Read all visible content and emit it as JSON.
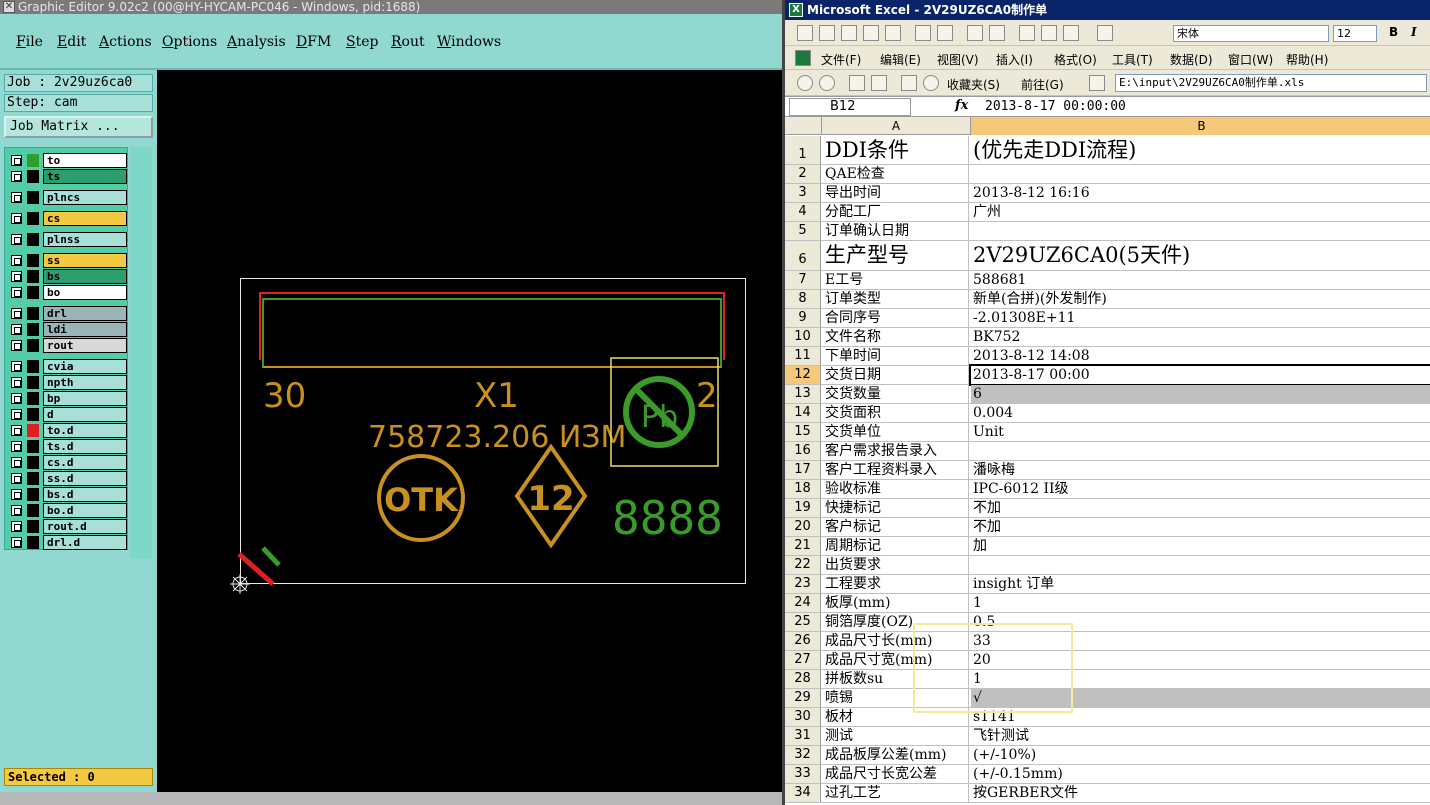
{
  "editor": {
    "title": "Graphic Editor 9.02c2 (00@HY-HYCAM-PC046 - Windows, pid:1688)",
    "menu": [
      "File",
      "Edit",
      "Actions",
      "Options",
      "Analysis",
      "DFM",
      "Step",
      "Rout",
      "Windows"
    ],
    "job": "Job : 2v29uz6ca0",
    "step": "Step: cam",
    "job_matrix_label": "Job Matrix ...",
    "layers": [
      {
        "name": "to",
        "color": "#ffffff",
        "swatch": "#2e9e2e"
      },
      {
        "name": "ts",
        "color": "#2e9e6e",
        "swatch": "#000000"
      },
      {
        "name": "plncs",
        "color": "#a8dfd8",
        "swatch": "#000000"
      },
      {
        "name": "cs",
        "color": "#f5c842",
        "swatch": "#000000"
      },
      {
        "name": "plnss",
        "color": "#a8dfd8",
        "swatch": "#000000"
      },
      {
        "name": "ss",
        "color": "#f5c842",
        "swatch": "#000000"
      },
      {
        "name": "bs",
        "color": "#2e9e6e",
        "swatch": "#000000"
      },
      {
        "name": "bo",
        "color": "#ffffff",
        "swatch": "#000000"
      },
      {
        "name": "drl",
        "color": "#9ab4b8",
        "swatch": "#000000"
      },
      {
        "name": "ldi",
        "color": "#9ab4b8",
        "swatch": "#000000"
      },
      {
        "name": "rout",
        "color": "#d8d8d8",
        "swatch": "#000000"
      },
      {
        "name": "cvia",
        "color": "#a8dfd8",
        "swatch": "#000000"
      },
      {
        "name": "npth",
        "color": "#a8dfd8",
        "swatch": "#000000"
      },
      {
        "name": "bp",
        "color": "#a8dfd8",
        "swatch": "#000000"
      },
      {
        "name": "d",
        "color": "#a8dfd8",
        "swatch": "#000000"
      },
      {
        "name": "to.d",
        "color": "#a8dfd8",
        "swatch": "#e02020"
      },
      {
        "name": "ts.d",
        "color": "#a8dfd8",
        "swatch": "#000000"
      },
      {
        "name": "cs.d",
        "color": "#a8dfd8",
        "swatch": "#000000"
      },
      {
        "name": "ss.d",
        "color": "#a8dfd8",
        "swatch": "#000000"
      },
      {
        "name": "bs.d",
        "color": "#a8dfd8",
        "swatch": "#000000"
      },
      {
        "name": "bo.d",
        "color": "#a8dfd8",
        "swatch": "#000000"
      },
      {
        "name": "rout.d",
        "color": "#a8dfd8",
        "swatch": "#000000"
      },
      {
        "name": "drl.d",
        "color": "#a8dfd8",
        "swatch": "#000000"
      }
    ],
    "selected": "Selected : 0",
    "canvas": {
      "t30": "30",
      "tx1": "X1",
      "t2": "2",
      "tpn": "758723.206 ИЗМ",
      "totk": "OTK",
      "t12": "12",
      "tpb": "Pb",
      "t8888": "8888",
      "orange": "#c8901e",
      "green": "#3a9a2a"
    }
  },
  "excel": {
    "title": "Microsoft Excel - 2V29UZ6CA0制作单",
    "menu": [
      "文件(F)",
      "编辑(E)",
      "视图(V)",
      "插入(I)",
      "格式(O)",
      "工具(T)",
      "数据(D)",
      "窗口(W)",
      "帮助(H)"
    ],
    "font": "宋体",
    "font_size": "12",
    "favorites": "收藏夹(S)",
    "goto": "前往(G)",
    "address": "E:\\input\\2V29UZ6CA0制作单.xls",
    "cell_ref": "B12",
    "fx": "fx",
    "formula": "2013-8-17  00:00:00",
    "col_a": "A",
    "col_b": "B",
    "rows": [
      {
        "n": "1",
        "a": "DDI条件",
        "b": "(优先走DDI流程)",
        "big": true
      },
      {
        "n": "2",
        "a": "QAE检查",
        "b": ""
      },
      {
        "n": "3",
        "a": "导出时间",
        "b": "2013-8-12 16:16"
      },
      {
        "n": "4",
        "a": "分配工厂",
        "b": "广州"
      },
      {
        "n": "5",
        "a": "订单确认日期",
        "b": ""
      },
      {
        "n": "6",
        "a": "生产型号",
        "b": "2V29UZ6CA0(5天件)",
        "big": true
      },
      {
        "n": "7",
        "a": "E工号",
        "b": "588681"
      },
      {
        "n": "8",
        "a": "订单类型",
        "b": "新单(合拼)(外发制作)"
      },
      {
        "n": "9",
        "a": "合同序号",
        "b": "-2.01308E+11"
      },
      {
        "n": "10",
        "a": "文件名称",
        "b": "BK752"
      },
      {
        "n": "11",
        "a": "下单时间",
        "b": "2013-8-12 14:08"
      },
      {
        "n": "12",
        "a": "交货日期",
        "b": "2013-8-17 00:00",
        "sel": true
      },
      {
        "n": "13",
        "a": "交货数量",
        "b": "6",
        "gray": true
      },
      {
        "n": "14",
        "a": "交货面积",
        "b": "0.004"
      },
      {
        "n": "15",
        "a": "交货单位",
        "b": "Unit"
      },
      {
        "n": "16",
        "a": "客户需求报告录入",
        "b": ""
      },
      {
        "n": "17",
        "a": "客户工程资料录入",
        "b": "潘咏梅"
      },
      {
        "n": "18",
        "a": "验收标准",
        "b": "IPC-6012 II级"
      },
      {
        "n": "19",
        "a": "快捷标记",
        "b": "不加"
      },
      {
        "n": "20",
        "a": "客户标记",
        "b": "不加"
      },
      {
        "n": "21",
        "a": "周期标记",
        "b": "加"
      },
      {
        "n": "22",
        "a": "出货要求",
        "b": ""
      },
      {
        "n": "23",
        "a": "工程要求",
        "b": "insight 订单"
      },
      {
        "n": "24",
        "a": "板厚(mm)",
        "b": "1"
      },
      {
        "n": "25",
        "a": "铜箔厚度(OZ)",
        "b": "0.5"
      },
      {
        "n": "26",
        "a": "成品尺寸长(mm)",
        "b": "33"
      },
      {
        "n": "27",
        "a": "成品尺寸宽(mm)",
        "b": "20"
      },
      {
        "n": "28",
        "a": "拼板数su",
        "b": "1"
      },
      {
        "n": "29",
        "a": "喷锡",
        "b": "√",
        "gray": true
      },
      {
        "n": "30",
        "a": "板材",
        "b": "s1141"
      },
      {
        "n": "31",
        "a": "测试",
        "b": "飞针测试"
      },
      {
        "n": "32",
        "a": "成品板厚公差(mm)",
        "b": "(+/-10%)"
      },
      {
        "n": "33",
        "a": "成品尺寸长宽公差",
        "b": "(+/-0.15mm)"
      },
      {
        "n": "34",
        "a": "过孔工艺",
        "b": "按GERBER文件"
      }
    ]
  }
}
